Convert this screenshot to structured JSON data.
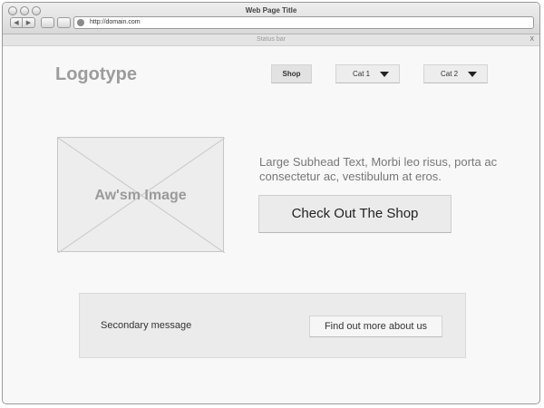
{
  "browser": {
    "title": "Web Page Title",
    "url": "http://domain.com",
    "back_glyph": "◀",
    "forward_glyph": "▶",
    "icons": [
      "globe-icon",
      "back-arrow-icon",
      "forward-arrow-icon",
      "close-icon"
    ]
  },
  "status_bar": {
    "text": "Status bar",
    "close": "X"
  },
  "header": {
    "logo": "Logotype",
    "nav": [
      {
        "label": "Shop",
        "active": true
      },
      {
        "label": "Cat 1",
        "dropdown": true
      },
      {
        "label": "Cat 2",
        "dropdown": true
      }
    ]
  },
  "hero": {
    "image_label": "Aw'sm Image",
    "subhead": "Large Subhead Text, Morbi leo risus, porta ac consectetur ac, vestibulum at eros.",
    "cta_label": "Check Out The Shop"
  },
  "secondary": {
    "message": "Secondary message",
    "button_label": "Find out more about us"
  },
  "colors": {
    "logo": "#9c9c9c",
    "button_bg": "#ebebeb",
    "page_bg": "#f8f8f8"
  }
}
